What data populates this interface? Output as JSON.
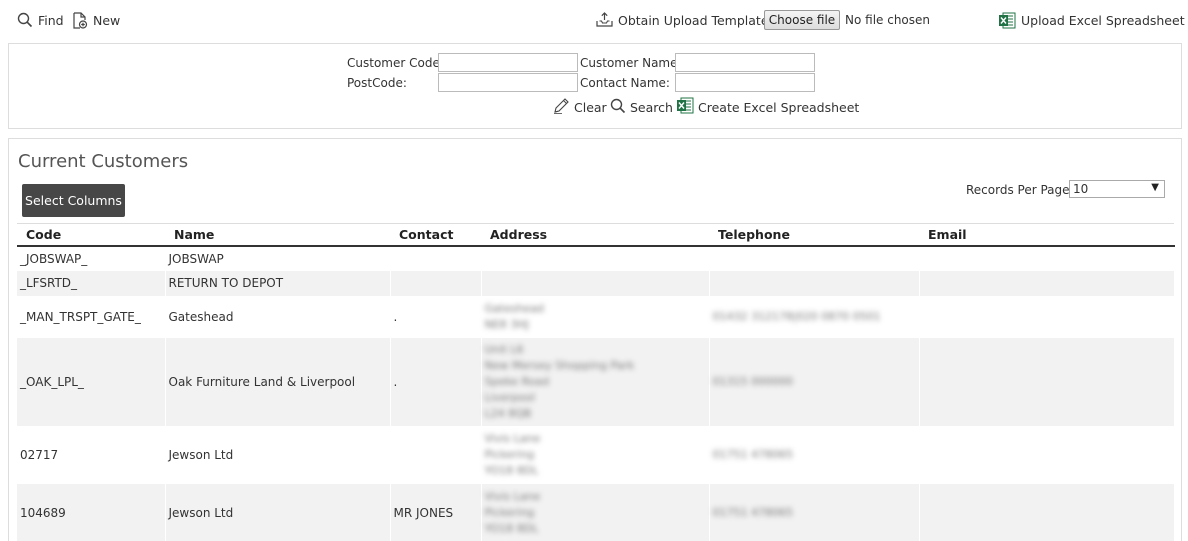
{
  "toolbar": {
    "find_label": "Find",
    "new_label": "New",
    "obtain_template_label": "Obtain Upload Template",
    "choose_file_label": "Choose file",
    "no_file_label": "No file chosen",
    "upload_excel_label": "Upload Excel Spreadsheet"
  },
  "filters": {
    "customer_code_label": "Customer Code:",
    "customer_code_value": "",
    "customer_name_label": "Customer Name:",
    "customer_name_value": "",
    "postcode_label": "PostCode:",
    "postcode_value": "",
    "contact_name_label": "Contact Name:",
    "contact_name_value": "",
    "clear_label": "Clear",
    "search_label": "Search",
    "create_excel_label": "Create Excel Spreadsheet"
  },
  "customers": {
    "title": "Current Customers",
    "select_columns_label": "Select Columns",
    "records_per_page_label": "Records Per Page:",
    "records_per_page_value": "10",
    "columns": [
      "Code",
      "Name",
      "Contact",
      "Address",
      "Telephone",
      "Email"
    ],
    "rows": [
      {
        "code": "_JOBSWAP_",
        "name": "JOBSWAP",
        "contact": "",
        "address": "",
        "telephone": "",
        "email": ""
      },
      {
        "code": "_LFSRTD_",
        "name": "RETURN TO DEPOT",
        "contact": "",
        "address": "",
        "telephone": "",
        "email": ""
      },
      {
        "code": "_MAN_TRSPT_GATE_",
        "name": "Gateshead",
        "contact": ".",
        "address": "Gateshead\nNE8 3HJ",
        "telephone": "01432 312178|020 0870 0501",
        "email": ""
      },
      {
        "code": "_OAK_LPL_",
        "name": "Oak Furniture Land & Liverpool",
        "contact": ".",
        "address": "Unit L6\nNew Mersey Shopping Park\nSpeke Road\nLiverpool\nL24 8QB",
        "telephone": "01315 000000",
        "email": ""
      },
      {
        "code": "02717",
        "name": "Jewson Ltd",
        "contact": "",
        "address": "Vivis Lane\nPickering\nYO18 8DL",
        "telephone": "01751 478065",
        "email": ""
      },
      {
        "code": "104689",
        "name": "Jewson Ltd",
        "contact": "MR JONES",
        "address": "Vivis Lane\nPickering\nYO18 8DL",
        "telephone": "01751 478065",
        "email": ""
      }
    ]
  }
}
